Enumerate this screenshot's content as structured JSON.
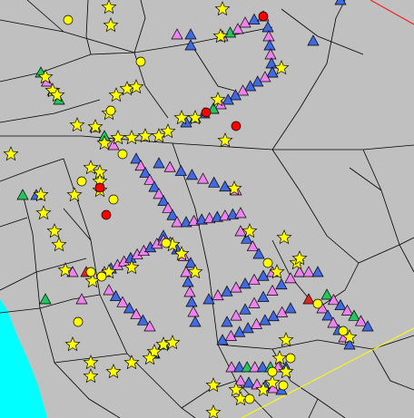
{
  "map": {
    "background": "#c0c0c0",
    "road_color": "#000000",
    "water_color": "#00ffff",
    "highlight_lines": [
      "#ff0000",
      "#ffff00"
    ],
    "legend_colors": {
      "star": "#ffff00",
      "circle_yellow": "#ffff00",
      "circle_red": "#ff0000",
      "triangle_blue": "#4169e1",
      "triangle_pink": "#ee82ee",
      "triangle_green": "#22c55e",
      "triangle_red": "#dc2626"
    }
  }
}
